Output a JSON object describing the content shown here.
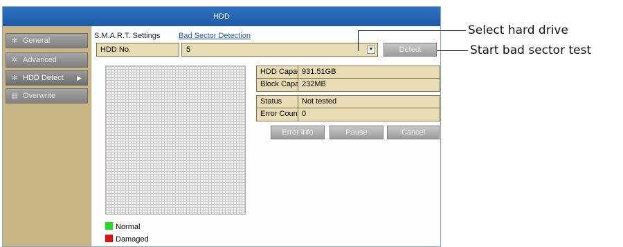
{
  "window": {
    "title": "HDD"
  },
  "sidebar": {
    "items": [
      {
        "label": "General",
        "icon": "gear-icon"
      },
      {
        "label": "Advanced",
        "icon": "gears-icon"
      },
      {
        "label": "HDD Detect",
        "icon": "gear-icon",
        "active": true
      },
      {
        "label": "Overwrite",
        "icon": "disk-icon"
      }
    ]
  },
  "tabs": {
    "smart": "S.M.A.R.T. Settings",
    "bad_sector": "Bad Sector Detection"
  },
  "hdd_select": {
    "label": "HDD No.",
    "value": "5"
  },
  "buttons": {
    "detect": "Detect",
    "error_info": "Error info",
    "pause": "Pause",
    "cancel": "Cancel"
  },
  "capacity": {
    "hdd_key": "HDD Capac...",
    "hdd_value": "931.51GB",
    "block_key": "Block Capa...",
    "block_value": "232MB"
  },
  "status_info": {
    "status_key": "Status",
    "status_value": "Not tested",
    "errors_key": "Error Count",
    "errors_value": "0"
  },
  "legend": {
    "normal": "Normal",
    "damaged": "Damaged"
  },
  "colors": {
    "normal": "#22dd22",
    "damaged": "#e01010",
    "accent": "#1e5aa8"
  },
  "callouts": {
    "select": "Select hard drive",
    "start": "Start bad sector test"
  }
}
